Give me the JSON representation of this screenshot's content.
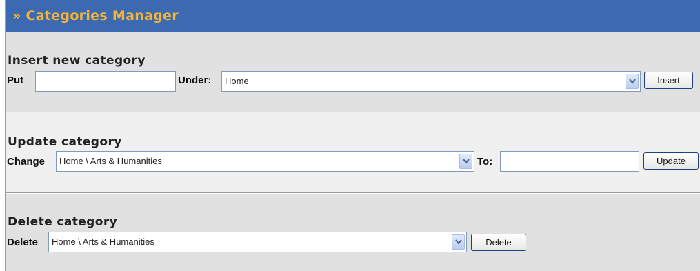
{
  "header": {
    "title": "» Categories Manager"
  },
  "insert": {
    "title": "Insert new category",
    "put_label": "Put",
    "put_value": "",
    "under_label": "Under:",
    "under_selected": "Home",
    "button": "Insert"
  },
  "update": {
    "title": "Update category",
    "change_label": "Change",
    "change_selected": "Home \\ Arts & Humanities",
    "to_label": "To:",
    "to_value": "",
    "button": "Update"
  },
  "delete": {
    "title": "Delete category",
    "delete_label": "Delete",
    "delete_selected": "Home \\ Arts & Humanities",
    "button": "Delete"
  },
  "icons": {
    "dropdown": "chevron-down-icon"
  },
  "colors": {
    "header_bg": "#3b6ab0",
    "header_text": "#f6b33a"
  }
}
